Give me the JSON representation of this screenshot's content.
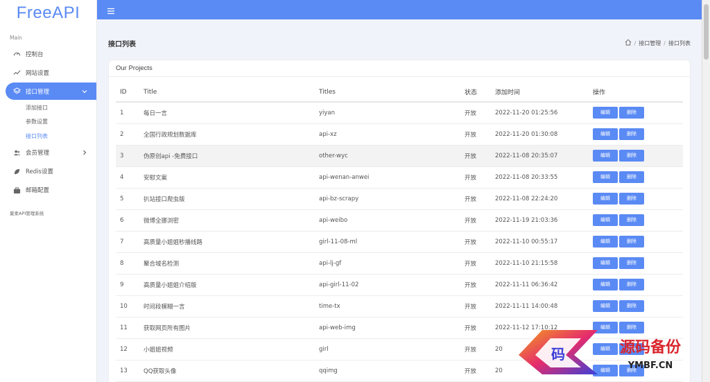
{
  "app": {
    "logo": "FreeAPI"
  },
  "sidebar": {
    "section": "Main",
    "items": [
      {
        "label": "控制台",
        "icon": "dashboard-icon"
      },
      {
        "label": "网站设置",
        "icon": "trend-line-icon"
      },
      {
        "label": "接口管理",
        "icon": "layers-icon",
        "active": true
      },
      {
        "label": "会员管理",
        "icon": "users-icon"
      },
      {
        "label": "Redis设置",
        "icon": "leaf-icon"
      },
      {
        "label": "邮箱配置",
        "icon": "briefcase-icon"
      }
    ],
    "sub_items": [
      "添加接口",
      "参数设置",
      "接口列表"
    ],
    "footer": "夏柔API管理系统"
  },
  "page": {
    "title": "接口列表",
    "breadcrumb": [
      "接口管理",
      "接口列表"
    ]
  },
  "card": {
    "title": "Our Projects"
  },
  "table": {
    "headers": {
      "id": "ID",
      "title": "Title",
      "titles": "Titles",
      "status": "状态",
      "time": "添加时间",
      "ops": "操作"
    },
    "edit_label": "编辑",
    "delete_label": "删除",
    "rows": [
      {
        "id": "1",
        "title": "每日一言",
        "titles": "yiyan",
        "status": "开放",
        "time": "2022-11-20 01:25:56"
      },
      {
        "id": "2",
        "title": "全国行政规划数据库",
        "titles": "api-xz",
        "status": "开放",
        "time": "2022-11-20 01:30:08"
      },
      {
        "id": "3",
        "title": "伪原创api -免费接口",
        "titles": "other-wyc",
        "status": "开放",
        "time": "2022-11-08 20:35:07"
      },
      {
        "id": "4",
        "title": "安慰文案",
        "titles": "api-wenan-anwei",
        "status": "开放",
        "time": "2022-11-08 20:33:55"
      },
      {
        "id": "5",
        "title": "扒站接口爬虫版",
        "titles": "api-bz-scrapy",
        "status": "开放",
        "time": "2022-11-08 22:24:20"
      },
      {
        "id": "6",
        "title": "微博全挪浏密",
        "titles": "api-weibo",
        "status": "开放",
        "time": "2022-11-19 21:03:36"
      },
      {
        "id": "7",
        "title": "高质量小姐姐秒播线路",
        "titles": "girl-11-08-ml",
        "status": "开放",
        "time": "2022-11-10 00:55:17"
      },
      {
        "id": "8",
        "title": "聚合域名检测",
        "titles": "api-lj-gf",
        "status": "开放",
        "time": "2022-11-10 21:15:58"
      },
      {
        "id": "9",
        "title": "高质量小姐姐介绍版",
        "titles": "api-girl-11-02",
        "status": "开放",
        "time": "2022-11-11 06:36:42"
      },
      {
        "id": "10",
        "title": "时间段模糊一言",
        "titles": "time-tx",
        "status": "开放",
        "time": "2022-11-11 14:00:48"
      },
      {
        "id": "11",
        "title": "获取网页所有图片",
        "titles": "api-web-img",
        "status": "开放",
        "time": "2022-11-12 17:10:12"
      },
      {
        "id": "12",
        "title": "小姐姐视频",
        "titles": "girl",
        "status": "开放",
        "time": "20"
      },
      {
        "id": "13",
        "title": "QQ获取头像",
        "titles": "qqimg",
        "status": "开放",
        "time": "20"
      }
    ]
  },
  "watermark": {
    "text": "源码备份",
    "url": "YMBF.CN"
  },
  "colors": {
    "accent": "#5a8af4",
    "watermark_red": "#d8262c"
  }
}
